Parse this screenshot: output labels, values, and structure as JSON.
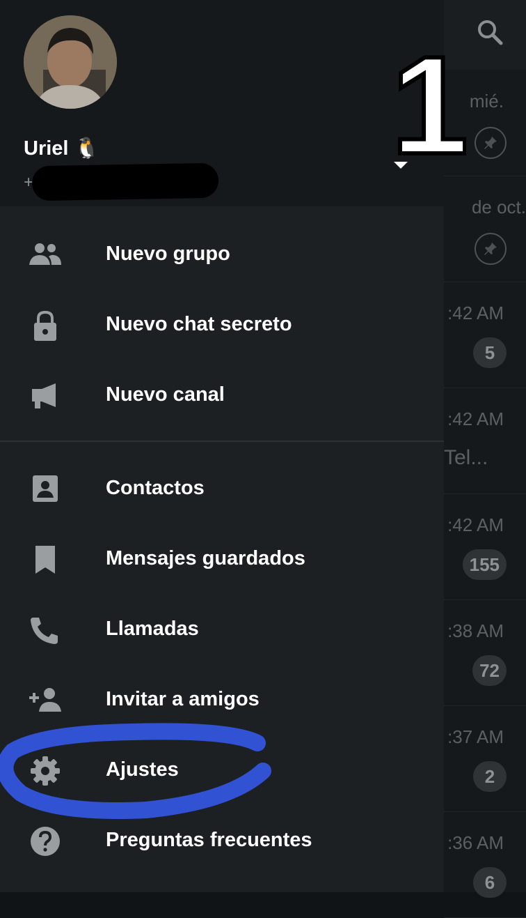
{
  "drawer": {
    "user": {
      "name": "Uriel 🐧",
      "phone": "+"
    },
    "menu_group1": [
      {
        "label": "Nuevo grupo",
        "icon": "group-icon"
      },
      {
        "label": "Nuevo chat secreto",
        "icon": "lock-icon"
      },
      {
        "label": "Nuevo canal",
        "icon": "megaphone-icon"
      }
    ],
    "menu_group2": [
      {
        "label": "Contactos",
        "icon": "contact-icon"
      },
      {
        "label": "Mensajes guardados",
        "icon": "bookmark-icon"
      },
      {
        "label": "Llamadas",
        "icon": "phone-icon"
      },
      {
        "label": "Invitar a amigos",
        "icon": "add-person-icon"
      },
      {
        "label": "Ajustes",
        "icon": "gear-icon"
      },
      {
        "label": "Preguntas frecuentes",
        "icon": "help-icon"
      }
    ]
  },
  "chat_list": {
    "rows": [
      {
        "time": "mié.",
        "pinned": true
      },
      {
        "time": "de oct.",
        "pinned": true
      },
      {
        "time": ":42 AM",
        "badge": "5"
      },
      {
        "time": ":42 AM",
        "preview": "Tel..."
      },
      {
        "time": ":42 AM",
        "badge": "155"
      },
      {
        "time": ":38 AM",
        "badge": "72"
      },
      {
        "time": ":37 AM",
        "badge": "2"
      },
      {
        "time": ":36 AM",
        "badge": "6"
      }
    ]
  },
  "annotation": {
    "number": "1",
    "highlight_color": "#3355dd"
  },
  "colors": {
    "drawer_bg": "#1c2023",
    "header_bg": "#16191b",
    "text": "#ffffff",
    "icon": "#9a9ea1"
  }
}
